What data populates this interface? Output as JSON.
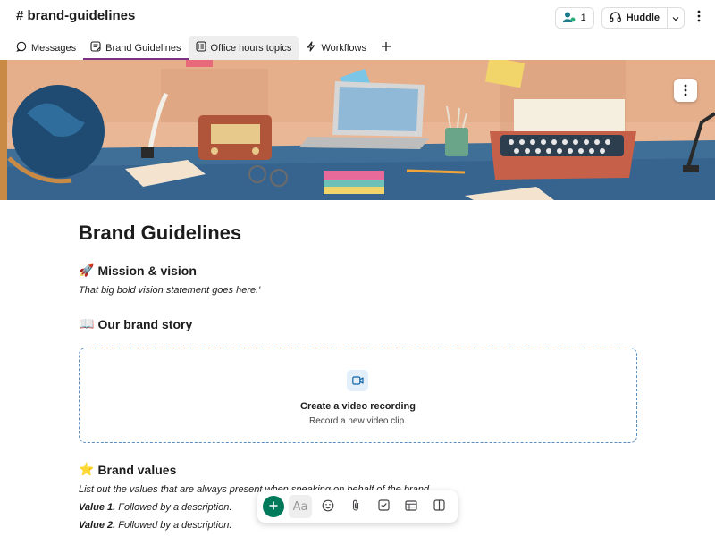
{
  "header": {
    "channel_name": "# brand-guidelines",
    "member_count": "1",
    "huddle_label": "Huddle"
  },
  "tabs": [
    {
      "label": "Messages",
      "icon": "chat-bubble-icon"
    },
    {
      "label": "Brand Guidelines",
      "icon": "canvas-icon"
    },
    {
      "label": "Office hours topics",
      "icon": "list-icon"
    },
    {
      "label": "Workflows",
      "icon": "lightning-icon"
    }
  ],
  "document": {
    "title": "Brand Guidelines",
    "mission": {
      "emoji": "🚀",
      "heading": "Mission & vision",
      "text": "That big bold vision statement goes here.'"
    },
    "story": {
      "emoji": "📖",
      "heading": "Our brand story"
    },
    "video": {
      "title": "Create a video recording",
      "subtitle": "Record a new video clip."
    },
    "values": {
      "emoji": "⭐",
      "heading": "Brand values",
      "intro": "List out the values that are always present when speaking on behalf of the brand.",
      "items": [
        {
          "label": "Value 1.",
          "text": " Followed by a description."
        },
        {
          "label": "Value 2.",
          "text": " Followed by a description."
        }
      ]
    }
  },
  "toolbar": {
    "format_label": "Aa"
  },
  "colors": {
    "active_tab": "#7c3085",
    "plus_button": "#007a5a",
    "dashed_border": "#5a8fc2"
  }
}
